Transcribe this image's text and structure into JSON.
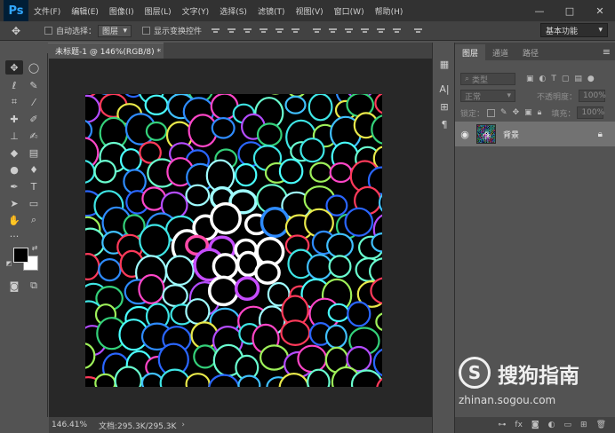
{
  "app": {
    "logo": "Ps"
  },
  "menubar": [
    "文件(F)",
    "编辑(E)",
    "图像(I)",
    "图层(L)",
    "文字(Y)",
    "选择(S)",
    "滤镜(T)",
    "视图(V)",
    "窗口(W)",
    "帮助(H)"
  ],
  "window_controls": {
    "minimize": "—",
    "restore": "□",
    "close": "✕"
  },
  "options": {
    "auto_select_label": "自动选择：",
    "auto_select_value": "图层",
    "transform_label": "显示变换控件",
    "workspace": "基本功能"
  },
  "document": {
    "tab_title": "未标题-1 @ 146%(RGB/8) *",
    "close": "×"
  },
  "status": {
    "zoom": "146.41%",
    "doc_info": "文档:295.3K/295.3K"
  },
  "layers_panel": {
    "tabs": [
      "图层",
      "通道",
      "路径"
    ],
    "filter_placeholder": "类型",
    "blend_mode": "正常",
    "opacity_label": "不透明度：",
    "opacity_value": "100%",
    "lock_label": "锁定：",
    "fill_label": "填充：",
    "fill_value": "100%",
    "layer_name": "背景"
  },
  "watermark": {
    "brand": "搜狗指南",
    "url": "zhinan.sogou.com",
    "logo_letter": "S"
  },
  "colors": {
    "accent": "#31a8ff",
    "canvas_bg": "#000000"
  }
}
